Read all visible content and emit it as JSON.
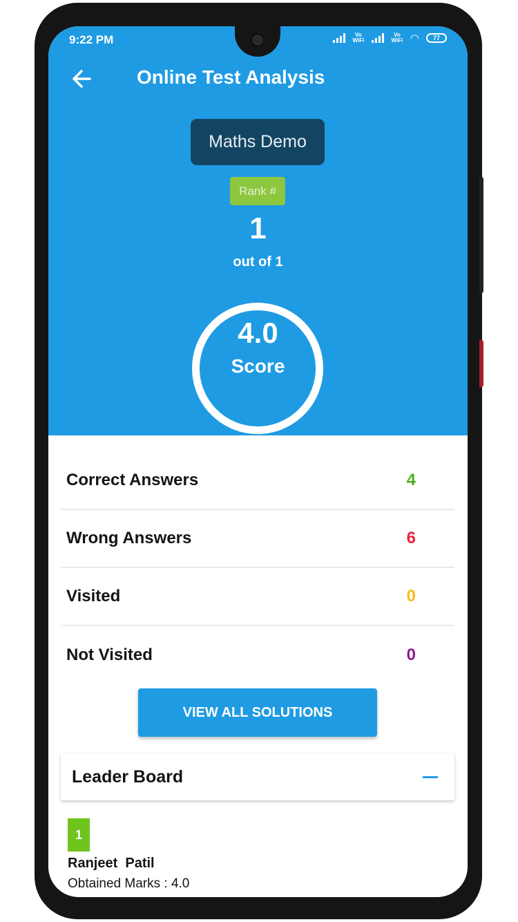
{
  "status_bar": {
    "time": "9:22 PM",
    "volte_label": "Vo WiFi",
    "battery": "77"
  },
  "header": {
    "title": "Online Test Analysis"
  },
  "test": {
    "name": "Maths Demo",
    "rank_label": "Rank #",
    "rank": "1",
    "rank_out_of": "out of 1"
  },
  "score": {
    "value": "4.0",
    "label": "Score"
  },
  "stats": [
    {
      "label": "Correct Answers",
      "value": "4",
      "color": "#4cae1e"
    },
    {
      "label": "Wrong Answers",
      "value": "6",
      "color": "#e8243a"
    },
    {
      "label": "Visited",
      "value": "0",
      "color": "#f7bd1a"
    },
    {
      "label": "Not Visited",
      "value": "0",
      "color": "#8a1d8f"
    }
  ],
  "solutions_button": {
    "label": "VIEW ALL SOLUTIONS"
  },
  "leaderboard": {
    "title": "Leader Board",
    "entries": [
      {
        "rank": "1",
        "name": "Ranjeet  Patil",
        "marks": "Obtained Marks : 4.0"
      }
    ]
  },
  "colors": {
    "primary": "#1f9be3",
    "test_chip": "#134563",
    "rank_badge": "#8dc63f"
  }
}
